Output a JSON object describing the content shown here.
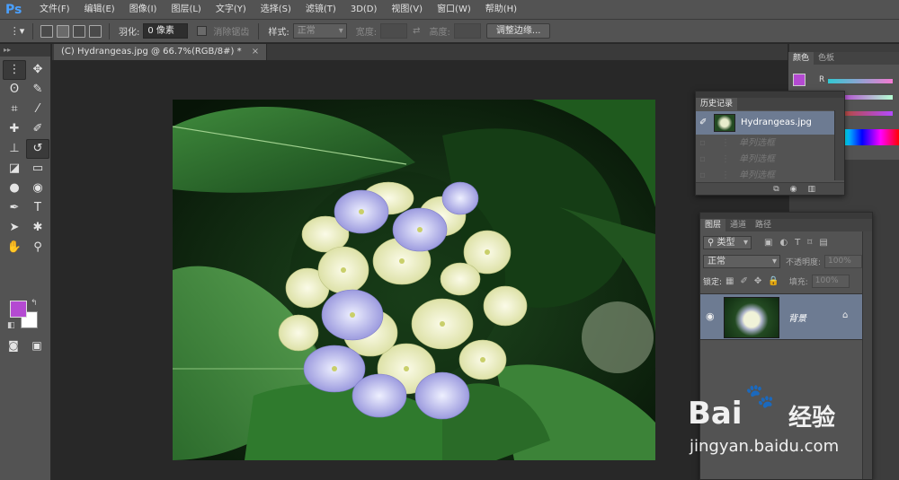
{
  "app": {
    "logo": "Ps",
    "menu": [
      "文件(F)",
      "编辑(E)",
      "图像(I)",
      "图层(L)",
      "文字(Y)",
      "选择(S)",
      "滤镜(T)",
      "3D(D)",
      "视图(V)",
      "窗口(W)",
      "帮助(H)"
    ]
  },
  "options": {
    "feather_label": "羽化:",
    "feather_value": "0 像素",
    "antialias_label": "消除锯齿",
    "style_label": "样式:",
    "style_value": "正常",
    "width_label": "宽度:",
    "height_label": "高度:",
    "refine_button": "调整边缘..."
  },
  "document": {
    "tab_title": "(C) Hydrangeas.jpg @ 66.7%(RGB/8#) *",
    "tab_close": "×"
  },
  "color_panel": {
    "tabs": [
      "颜色",
      "色板"
    ],
    "channel_label": "R",
    "foreground_color": "#b44ad2",
    "background_color": "#ffffff"
  },
  "history_panel": {
    "tab": "历史记录",
    "snapshot_name": "Hydrangeas.jpg",
    "ghost_states": [
      "单列选框",
      "单列选框",
      "单列选框"
    ]
  },
  "layers_panel": {
    "tabs": [
      "图层",
      "通道",
      "路径"
    ],
    "filter_kind": "类型",
    "blend_mode": "正常",
    "opacity_label": "不透明度:",
    "opacity_value": "100%",
    "lock_label": "锁定:",
    "fill_label": "填充:",
    "fill_value": "100%",
    "layer_name": "背景"
  },
  "watermark": {
    "brand": "Bai",
    "brand_suffix": "经验",
    "url": "jingyan.baidu.com"
  }
}
